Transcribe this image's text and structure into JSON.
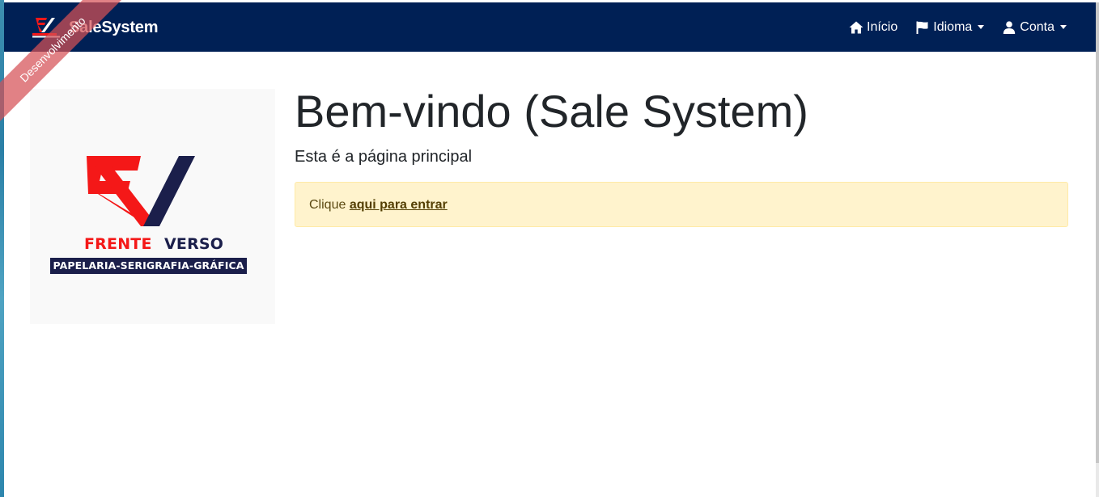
{
  "app": {
    "name": "SaleSystem",
    "environment_ribbon": "Desenvolvimento"
  },
  "navbar": {
    "links": [
      {
        "label": "Início",
        "icon": "home-icon"
      },
      {
        "label": "Idioma",
        "icon": "flag-icon",
        "dropdown": true
      },
      {
        "label": "Conta",
        "icon": "user-icon",
        "dropdown": true
      }
    ]
  },
  "logo": {
    "word_left": "FRENTE",
    "word_right": "VERSO",
    "tagline": "PAPELARIA-SERIGRAFIA-GRÁFICA"
  },
  "main": {
    "title": "Bem-vindo (Sale System)",
    "subtitle": "Esta é a página principal",
    "alert_prefix": "Clique",
    "alert_link": "aqui para entrar"
  },
  "colors": {
    "navbar": "#002055",
    "alert_background": "#fff3cd",
    "logo_red": "#f41818",
    "logo_navy": "#1b1f4b",
    "ribbon": "#d65056"
  }
}
